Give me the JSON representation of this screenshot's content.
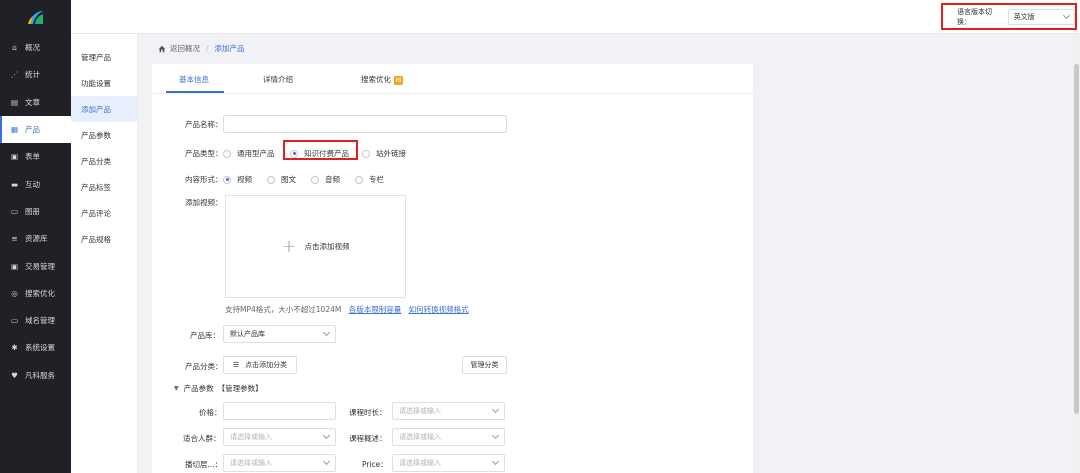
{
  "sidebar": {
    "items": [
      {
        "label": "概况",
        "icon": "home-icon"
      },
      {
        "label": "统计",
        "icon": "chart-icon"
      },
      {
        "label": "文章",
        "icon": "article-icon"
      },
      {
        "label": "产品",
        "icon": "grid-icon"
      },
      {
        "label": "表单",
        "icon": "form-icon"
      },
      {
        "label": "互动",
        "icon": "chat-icon"
      },
      {
        "label": "图册",
        "icon": "album-icon"
      },
      {
        "label": "资源库",
        "icon": "database-icon"
      },
      {
        "label": "交易管理",
        "icon": "trade-icon"
      },
      {
        "label": "搜索优化",
        "icon": "seo-icon"
      },
      {
        "label": "域名管理",
        "icon": "domain-icon"
      },
      {
        "label": "系统设置",
        "icon": "gear-icon"
      },
      {
        "label": "凡科服务",
        "icon": "heart-icon"
      }
    ],
    "active_index": 3
  },
  "header": {
    "lang_label": "语言版本切换：",
    "lang_value": "英文版"
  },
  "subnav": {
    "items": [
      "管理产品",
      "功能设置",
      "添加产品",
      "产品参数",
      "产品分类",
      "产品标签",
      "产品评论",
      "产品规格"
    ],
    "active_index": 2
  },
  "breadcrumb": {
    "back": "返回概况",
    "separator": "/",
    "current": "添加产品"
  },
  "tabs": {
    "basic": "基本信息",
    "detail": "详情介绍",
    "seo": "搜索优化",
    "seo_badge": "Hi"
  },
  "form": {
    "name_label": "产品名称：",
    "type_label": "产品类型：",
    "type_options": [
      "通用型产品",
      "知识付费产品",
      "站外链接"
    ],
    "type_selected": "知识付费产品",
    "content_label": "内容形式：",
    "content_options": [
      "视频",
      "图文",
      "音频",
      "专栏"
    ],
    "content_selected": "视频",
    "video_label": "添加视频：",
    "upload_text": "点击添加视频",
    "hint_text": "支持MP4格式，大小不超过1024M",
    "hint_link1": "各版本限制容量",
    "hint_link2": "如何转换视频格式",
    "library_label": "产品库：",
    "library_value": "默认产品库",
    "category_label": "产品分类：",
    "category_button": "点击添加分类",
    "manage_category": "管理分类",
    "params_title": "产品参数",
    "params_manage": "【管理参数】",
    "price_label": "价格：",
    "duration_label": "课程时长：",
    "audience_label": "适合人群：",
    "overview_label": "课程概述：",
    "broadcast_label": "播切层...：",
    "price_en_label": "Price：",
    "placeholder": "请选择或输入"
  }
}
